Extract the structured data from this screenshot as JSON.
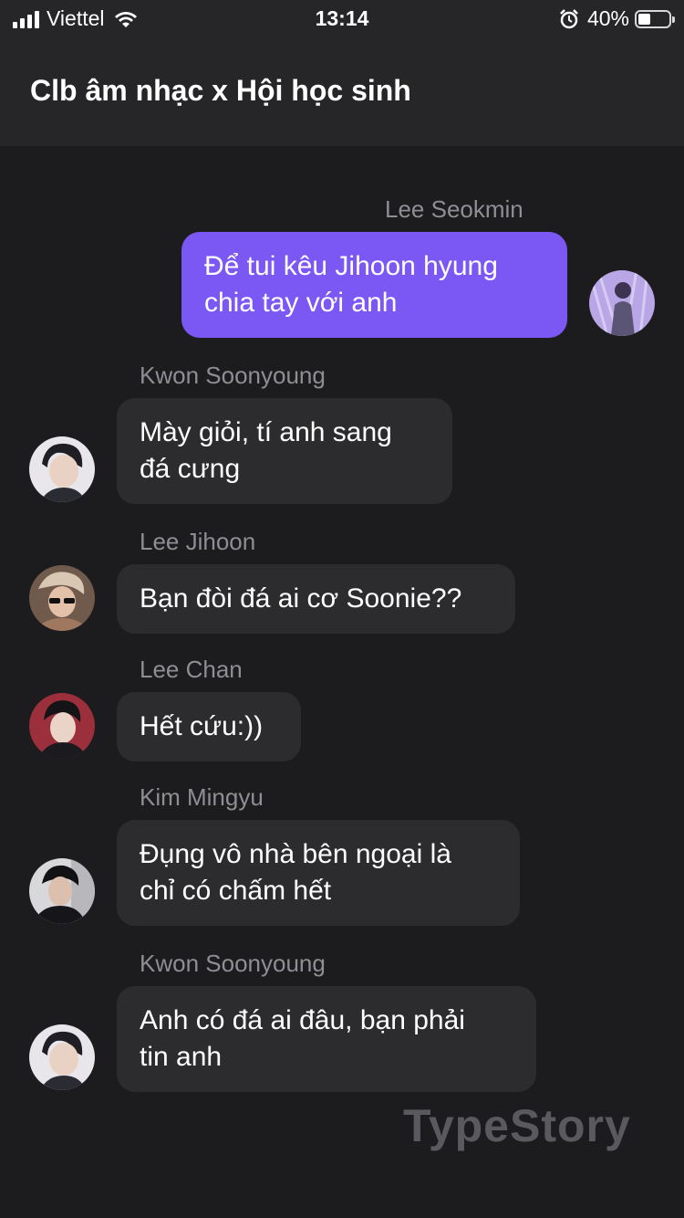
{
  "status_bar": {
    "carrier": "Viettel",
    "time": "13:14",
    "battery_percent": "40%",
    "battery_level": 0.4
  },
  "header": {
    "title": "Clb âm nhạc x Hội học sinh"
  },
  "messages": [
    {
      "sender": "Lee Seokmin",
      "lines": [
        "Để tui kêu Jihoon hyung",
        "chia tay với anh"
      ],
      "outgoing": true
    },
    {
      "sender": "Kwon Soonyoung",
      "lines": [
        "Mày giỏi, tí anh sang",
        "đá cưng"
      ],
      "outgoing": false
    },
    {
      "sender": "Lee Jihoon",
      "lines": [
        "Bạn đòi đá ai cơ Soonie??"
      ],
      "outgoing": false
    },
    {
      "sender": "Lee Chan",
      "lines": [
        "Hết cứu:))"
      ],
      "outgoing": false
    },
    {
      "sender": "Kim Mingyu",
      "lines": [
        "Đụng vô nhà bên ngoại là",
        "chỉ có chấm hết"
      ],
      "outgoing": false
    },
    {
      "sender": "Kwon Soonyoung",
      "lines": [
        "Anh có đá ai đâu, bạn phải",
        "tin anh"
      ],
      "outgoing": false
    }
  ],
  "watermark": "TypeStory",
  "colors": {
    "background": "#1c1c1e",
    "header": "#262628",
    "outgoing_bubble": "#7b57f4",
    "incoming_bubble": "#2c2c2e",
    "sender_name": "#8e8e93"
  }
}
